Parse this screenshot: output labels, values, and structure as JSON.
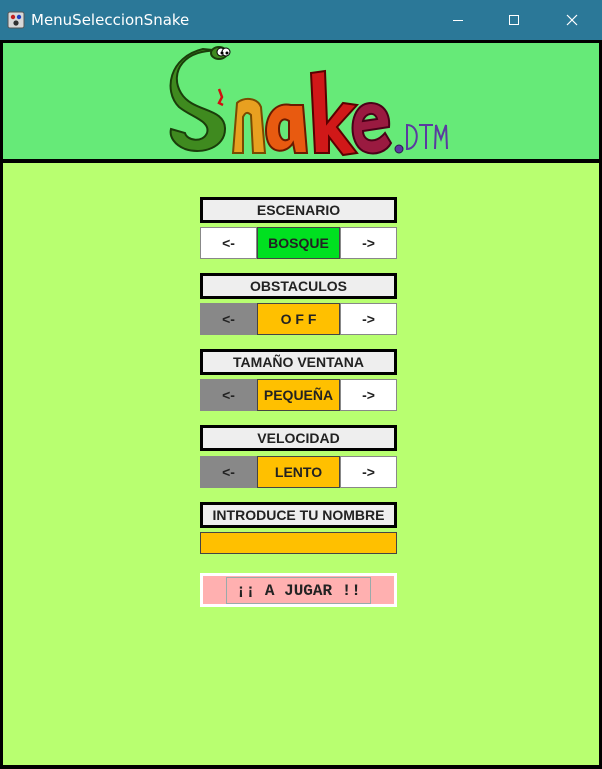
{
  "window": {
    "title": "MenuSeleccionSnake",
    "controls": [
      "minimize",
      "maximize",
      "close"
    ]
  },
  "banner": {
    "logo_text": "Snake.DTM",
    "background": "#66ea78"
  },
  "menu": {
    "background": "#b8ff70",
    "scenario": {
      "label": "ESCENARIO",
      "prev": "<-",
      "value": "BOSQUE",
      "next": "->",
      "value_color": "#00e020"
    },
    "obstacles": {
      "label": "OBSTACULOS",
      "prev": "<-",
      "value": "O F F",
      "next": "->",
      "value_color": "#ffc000"
    },
    "window_size": {
      "label": "TAMAÑO VENTANA",
      "prev": "<-",
      "value": "PEQUEÑA",
      "next": "->",
      "value_color": "#ffc000"
    },
    "speed": {
      "label": "VELOCIDAD",
      "prev": "<-",
      "value": "LENTO",
      "next": "->",
      "value_color": "#ffc000"
    },
    "name": {
      "label": "INTRODUCE TU NOMBRE",
      "value": "",
      "placeholder": ""
    },
    "play_label": "¡¡ A JUGAR !!"
  }
}
